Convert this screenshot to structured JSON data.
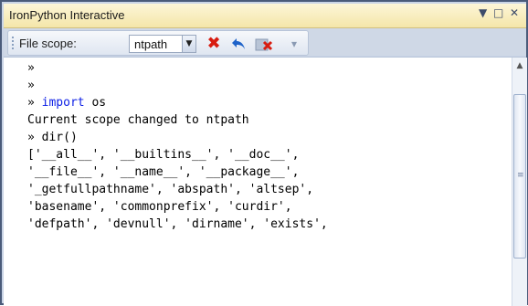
{
  "window": {
    "title": "IronPython Interactive"
  },
  "window_controls": {
    "dropdown_glyph": "▼",
    "maximize_glyph": "□",
    "close_glyph": "✕"
  },
  "toolbar": {
    "scope_label": "File scope:",
    "scope_value": "ntpath",
    "icons": [
      "reset-scope-icon",
      "undo-icon",
      "clear-icon"
    ]
  },
  "repl": {
    "lines": [
      "»",
      "»",
      "» import os",
      "Current scope changed to ntpath",
      "» dir()",
      "['__all__', '__builtins__', '__doc__',",
      "'__file__', '__name__', '__package__',",
      "'_getfullpathname', 'abspath', 'altsep',",
      "'basename', 'commonprefix', 'curdir',",
      "'defpath', 'devnull', 'dirname', 'exists',"
    ]
  },
  "colors": {
    "keyword": "#1022e6",
    "title_bar": "#f4e6a9",
    "frame": "#4a5b7a"
  }
}
